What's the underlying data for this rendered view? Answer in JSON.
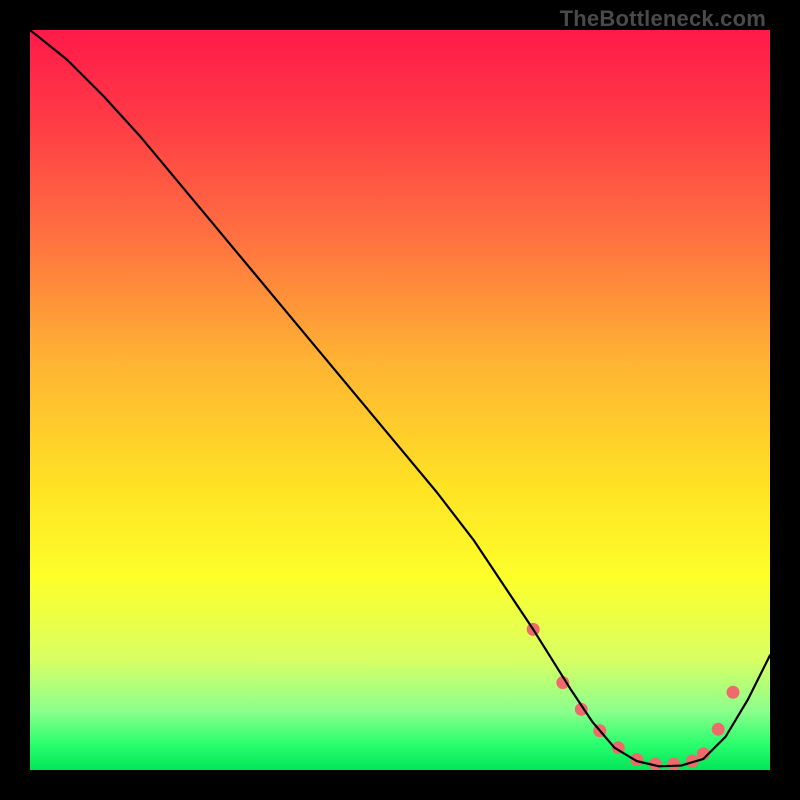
{
  "attribution": "TheBottleneck.com",
  "chart_data": {
    "type": "line",
    "title": "",
    "xlabel": "",
    "ylabel": "",
    "xlim": [
      0,
      100
    ],
    "ylim": [
      0,
      100
    ],
    "grid": false,
    "legend": false,
    "background_gradient": {
      "stops": [
        {
          "offset": 0.0,
          "color": "#ff1a49"
        },
        {
          "offset": 0.12,
          "color": "#ff3a46"
        },
        {
          "offset": 0.28,
          "color": "#ff7140"
        },
        {
          "offset": 0.45,
          "color": "#ffb433"
        },
        {
          "offset": 0.62,
          "color": "#ffe324"
        },
        {
          "offset": 0.74,
          "color": "#fdff2a"
        },
        {
          "offset": 0.85,
          "color": "#d9ff63"
        },
        {
          "offset": 0.92,
          "color": "#8cff8c"
        },
        {
          "offset": 0.965,
          "color": "#2bff6e"
        },
        {
          "offset": 1.0,
          "color": "#00e558"
        }
      ]
    },
    "series": [
      {
        "name": "bottleneck-curve",
        "color": "#000000",
        "stroke_width": 2.2,
        "x": [
          0,
          5,
          10,
          15,
          20,
          25,
          30,
          35,
          40,
          45,
          50,
          55,
          60,
          64,
          68,
          70,
          73,
          76,
          79,
          82,
          85,
          88,
          91,
          94,
          97,
          100
        ],
        "y": [
          100,
          96,
          91,
          85.5,
          79.5,
          73.5,
          67.5,
          61.5,
          55.5,
          49.5,
          43.5,
          37.5,
          31,
          25,
          19,
          15.8,
          11,
          6.5,
          3,
          1.2,
          0.5,
          0.6,
          1.5,
          4.5,
          9.5,
          15.5
        ]
      }
    ],
    "markers": {
      "name": "highlight-points",
      "color": "#ef6a6a",
      "radius": 6.5,
      "x": [
        68,
        72,
        74.5,
        77,
        79.5,
        82,
        84.5,
        87,
        89.5,
        91,
        93,
        95
      ],
      "y": [
        19,
        11.8,
        8.2,
        5.3,
        3.0,
        1.4,
        0.8,
        0.8,
        1.2,
        2.2,
        5.5,
        10.5
      ]
    }
  }
}
